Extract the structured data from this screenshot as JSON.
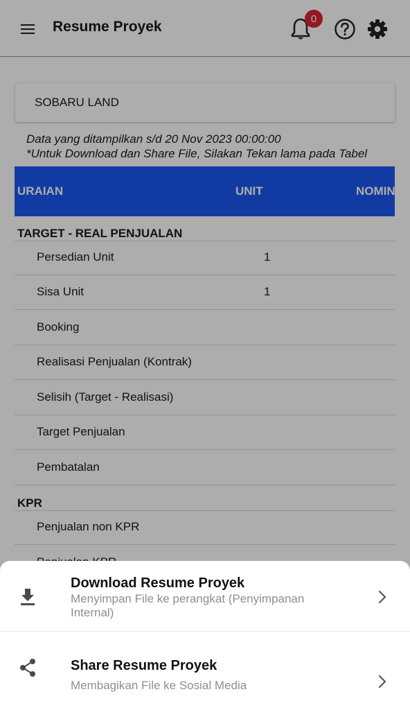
{
  "header": {
    "title": "Resume Proyek",
    "notification_count": "0",
    "icons": [
      "menu-icon",
      "bell-icon",
      "help-icon",
      "gear-icon"
    ]
  },
  "project": {
    "name": "SOBARU LAND"
  },
  "info": {
    "line1": "Data yang ditampilkan s/d 20 Nov 2023 00:00:00",
    "line2": "*Untuk Download dan Share File, Silakan Tekan lama pada Tabel"
  },
  "table": {
    "columns": [
      "URAIAN",
      "UNIT",
      "NOMIN"
    ],
    "sections": [
      {
        "title": "TARGET - REAL PENJUALAN",
        "rows": [
          {
            "label": "Persedian Unit",
            "unit": "1"
          },
          {
            "label": "Sisa Unit",
            "unit": "1"
          },
          {
            "label": "Booking",
            "unit": ""
          },
          {
            "label": "Realisasi Penjualan (Kontrak)",
            "unit": ""
          },
          {
            "label": "Selisih (Target - Realisasi)",
            "unit": ""
          },
          {
            "label": "Target Penjualan",
            "unit": ""
          },
          {
            "label": "Pembatalan",
            "unit": ""
          }
        ]
      },
      {
        "title": "KPR",
        "rows": [
          {
            "label": "Penjualan non KPR",
            "unit": ""
          },
          {
            "label": "Penjualan KPR",
            "unit": ""
          }
        ]
      }
    ]
  },
  "sheet": {
    "items": [
      {
        "title": "Download Resume Proyek",
        "subtitle": "Menyimpan File ke perangkat (Penyimpanan Internal)",
        "icon": "download-icon"
      },
      {
        "title": "Share Resume Proyek",
        "subtitle": "Membagikan File ke Sosial Media",
        "icon": "share-icon"
      }
    ]
  },
  "colors": {
    "table_header": "#1a56f0",
    "badge": "#d8262f",
    "scrim": "rgba(0,0,0,0.32)"
  }
}
